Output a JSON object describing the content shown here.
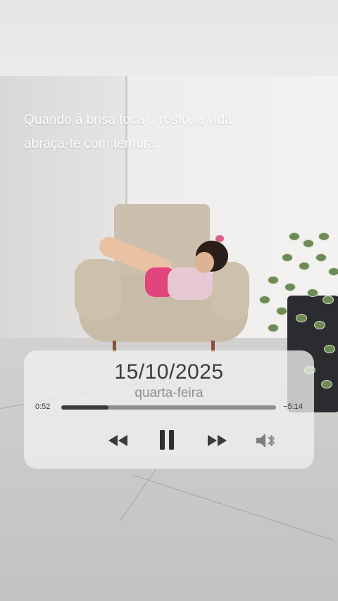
{
  "quote": {
    "line1": "Quando a brisa toca o rosto, a vida",
    "line2": "abraça-te com ternura."
  },
  "player": {
    "date": "15/10/2025",
    "weekday": "quarta-feira",
    "elapsed": "0:52",
    "remaining": "−5:14",
    "progress": 0.22,
    "controls": [
      "rewind-icon",
      "pause-icon",
      "fast-forward-icon",
      "speaker-bluetooth-icon"
    ]
  },
  "colors": {
    "panel": "#f0efee",
    "text_dark": "#3c3c3c",
    "text_muted": "#8f8f8f",
    "quote_text": "#ffffff"
  }
}
